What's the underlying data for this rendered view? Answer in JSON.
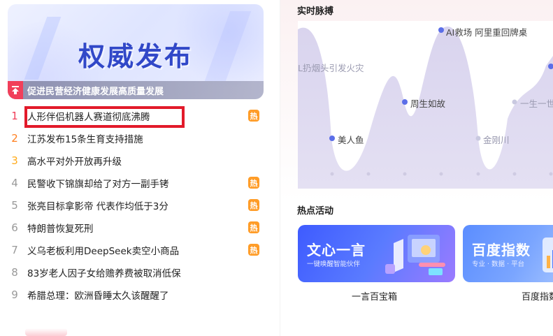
{
  "left": {
    "banner": {
      "title": "权威发布",
      "pin_icon": "置顶",
      "bar_text": "促进民营经济健康发展高质量发展"
    },
    "hot_list": [
      {
        "rank": "1",
        "title": "人形伴侣机器人赛道彻底沸腾",
        "badge": "热"
      },
      {
        "rank": "2",
        "title": "江苏发布15条生育支持措施",
        "badge": ""
      },
      {
        "rank": "3",
        "title": "高水平对外开放再升级",
        "badge": ""
      },
      {
        "rank": "4",
        "title": "民警收下锦旗却给了对方一副手铐",
        "badge": "热"
      },
      {
        "rank": "5",
        "title": "张亮目标拿影帝 代表作均低于3分",
        "badge": "热"
      },
      {
        "rank": "6",
        "title": "特朗普恢复死刑",
        "badge": "热"
      },
      {
        "rank": "7",
        "title": "义乌老板利用DeepSeek卖空小商品",
        "badge": "热"
      },
      {
        "rank": "8",
        "title": "83岁老人因子女给赡养费被取消低保",
        "badge": ""
      },
      {
        "rank": "9",
        "title": "希腊总理：欧洲昏睡太久该醒醒了",
        "badge": ""
      }
    ]
  },
  "right": {
    "pulse_title": "实时脉搏",
    "pulse_labels": [
      {
        "text": "AI救场 阿里重回牌桌",
        "style": "dark"
      },
      {
        "text": "L扔烟头引发火灾",
        "style": "light"
      },
      {
        "text": "周生如故",
        "style": "dark"
      },
      {
        "text": "美人鱼",
        "style": "dark"
      },
      {
        "text": "金刚川",
        "style": "light"
      },
      {
        "text": "一生一世",
        "style": "light"
      }
    ],
    "events_title": "热点活动",
    "events": [
      {
        "head": "文心一言",
        "sub": "一键唤醒智能伙伴",
        "caption": "一言百宝箱"
      },
      {
        "head": "百度指数",
        "sub": "专业 · 数据 · 平台",
        "caption": "百度指数"
      }
    ]
  },
  "colors": {
    "accent_red": "#f13f5a",
    "rank2": "#ff7f1f",
    "rank3": "#ffab1b",
    "hot_badge": "#ff9c27",
    "highlight": "#e21a2a",
    "banner_title": "#3148c8",
    "chart_point": "#5b6ee8"
  }
}
